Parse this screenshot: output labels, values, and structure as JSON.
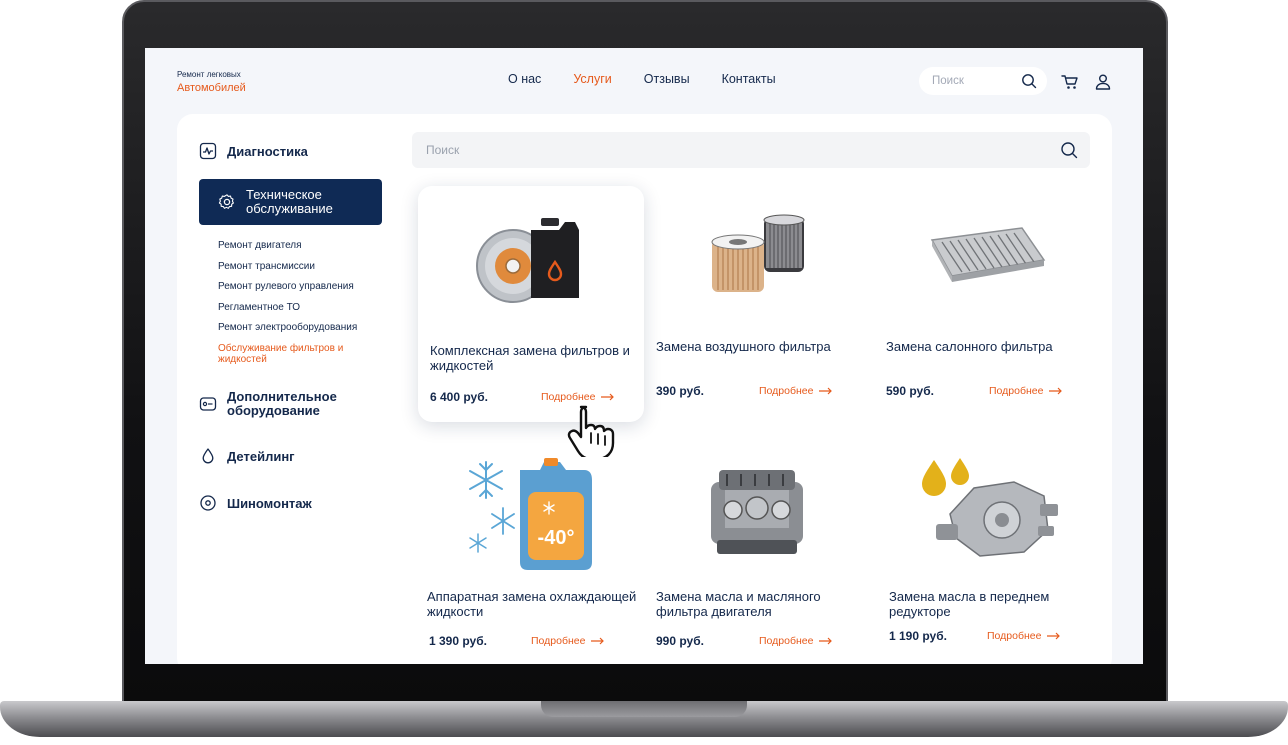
{
  "brand": {
    "small": "Ремонт легковых",
    "main": "Автомобилей"
  },
  "nav": [
    {
      "label": "О нас",
      "active": false
    },
    {
      "label": "Услуги",
      "active": true
    },
    {
      "label": "Отзывы",
      "active": false
    },
    {
      "label": "Контакты",
      "active": false
    }
  ],
  "header_search": {
    "placeholder": "Поиск",
    "icon": "search-icon"
  },
  "header_icons": [
    "cart-icon",
    "user-icon"
  ],
  "sidebar": {
    "items": [
      {
        "label": "Диагностика",
        "icon": "pulse-icon",
        "active": false
      },
      {
        "label": "Техническое обслуживание",
        "icon": "gear-icon",
        "active": true
      },
      {
        "label": "Дополнительное оборудование",
        "icon": "equipment-icon",
        "active": false
      },
      {
        "label": "Детейлинг",
        "icon": "drop-icon",
        "active": false
      },
      {
        "label": "Шиномонтаж",
        "icon": "tire-icon",
        "active": false
      }
    ],
    "subitems": [
      {
        "label": "Ремонт двигателя",
        "active": false
      },
      {
        "label": "Ремонт трансмиссии",
        "active": false
      },
      {
        "label": "Ремонт рулевого управления",
        "active": false
      },
      {
        "label": "Регламентное ТО",
        "active": false
      },
      {
        "label": "Ремонт электрооборудования",
        "active": false
      },
      {
        "label": "Обслуживание фильтров и жидкостей",
        "active": true
      }
    ]
  },
  "content_search": {
    "placeholder": "Поиск",
    "icon": "search-icon"
  },
  "more_label": "Подробнее",
  "products": [
    {
      "title": "Комплексная замена фильтров и жидкостей",
      "price": "6 400 руб.",
      "image": "brake-disc-oil-can",
      "highlighted": true
    },
    {
      "title": "Замена воздушного фильтра",
      "price": "390 руб.",
      "image": "air-filters",
      "highlighted": false
    },
    {
      "title": "Замена салонного фильтра",
      "price": "590 руб.",
      "image": "cabin-filter",
      "highlighted": false
    },
    {
      "title": "Аппаратная замена охлаждающей жидкости",
      "price": "1 390 руб.",
      "image": "antifreeze-can",
      "highlighted": false
    },
    {
      "title": "Замена масла и масляного фильтра двигателя",
      "price": "990 руб.",
      "image": "engine",
      "highlighted": false
    },
    {
      "title": "Замена масла в переднем редукторе",
      "price": "1 190 руб.",
      "image": "gearbox-oil-drops",
      "highlighted": false
    }
  ],
  "antifreeze_label": "-40°",
  "colors": {
    "accent": "#e65a1c",
    "navy": "#0f2a55",
    "text": "#14284b",
    "screen_bg": "#f4f6fa"
  }
}
